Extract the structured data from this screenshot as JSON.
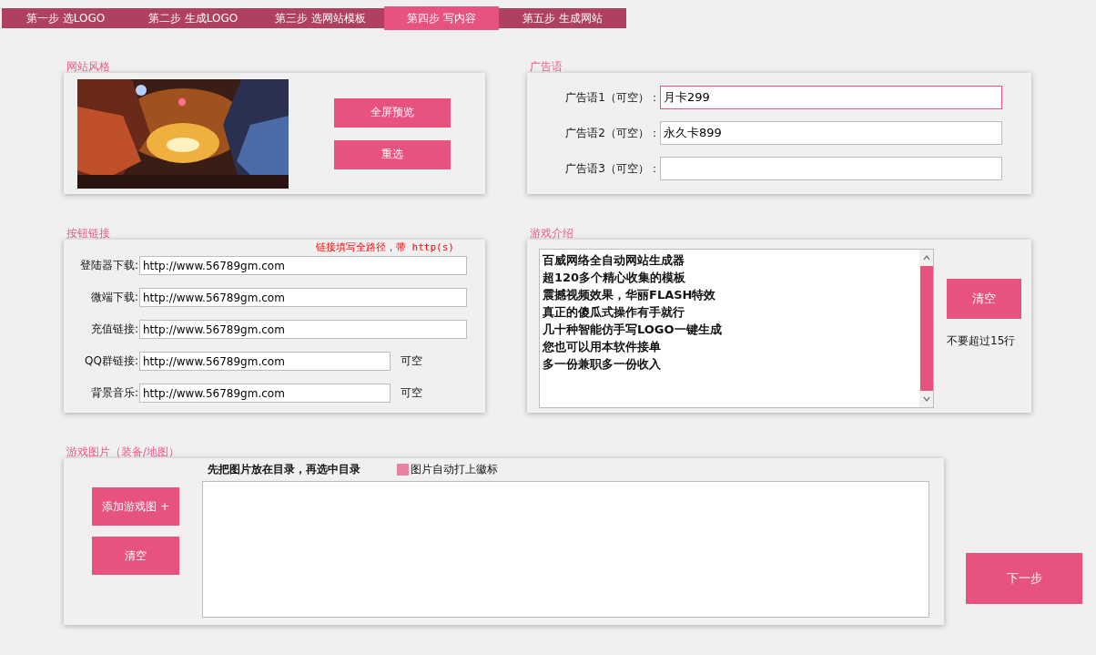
{
  "steps": [
    {
      "label": "第一步 选LOGO",
      "selected": false
    },
    {
      "label": "第二步 生成LOGO",
      "selected": false
    },
    {
      "label": "第三步 选网站模板",
      "selected": false
    },
    {
      "label": "第四步 写内容",
      "selected": true
    },
    {
      "label": "第五步 生成网站",
      "selected": false
    }
  ],
  "style_panel": {
    "title": "网站风格",
    "buttons": [
      "全屏预览",
      "重选"
    ]
  },
  "slogan_panel": {
    "title": "广告语",
    "fields": [
      {
        "label": "广告语1（可空）：",
        "value": "月卡299",
        "focused": true
      },
      {
        "label": "广告语2（可空）：",
        "value": "永久卡899",
        "focused": false
      },
      {
        "label": "广告语3（可空）：",
        "focused": false
      }
    ]
  },
  "links_panel": {
    "title": "按钮链接",
    "hint": "链接填写全路径，带 http(s)",
    "fields": [
      {
        "label": "登陆器下载:",
        "value": "http://www.56789gm.com"
      },
      {
        "label": "微端下载:",
        "value": "http://www.56789gm.com"
      },
      {
        "label": "充值链接:",
        "value": "http://www.56789gm.com"
      },
      {
        "label": "QQ群链接:",
        "value": "http://www.56789gm.com",
        "note": "可空"
      },
      {
        "label": "背景音乐:",
        "value": "http://www.56789gm.com",
        "note": "可空"
      }
    ]
  },
  "intro_panel": {
    "title": "游戏介绍",
    "lines": [
      "百威网络全自动网站生成器",
      "超120多个精心收集的模板",
      "震撼视频效果，华丽FLASH特效",
      "真正的傻瓜式操作有手就行",
      "几十种智能仿手写LOGO一键生成",
      "您也可以用本软件接单",
      "多一份兼职多一份收入"
    ],
    "clear_button": "清空",
    "note": "不要超过15行"
  },
  "images_panel": {
    "title": "游戏图片（装备/地图）",
    "instruction": "先把图片放在目录，再选中目录",
    "watermark_checkbox": {
      "label": "图片自动打上徽标",
      "checked": true
    },
    "buttons": [
      "添加游戏图 +",
      "清空"
    ]
  },
  "next_button": "下一步"
}
